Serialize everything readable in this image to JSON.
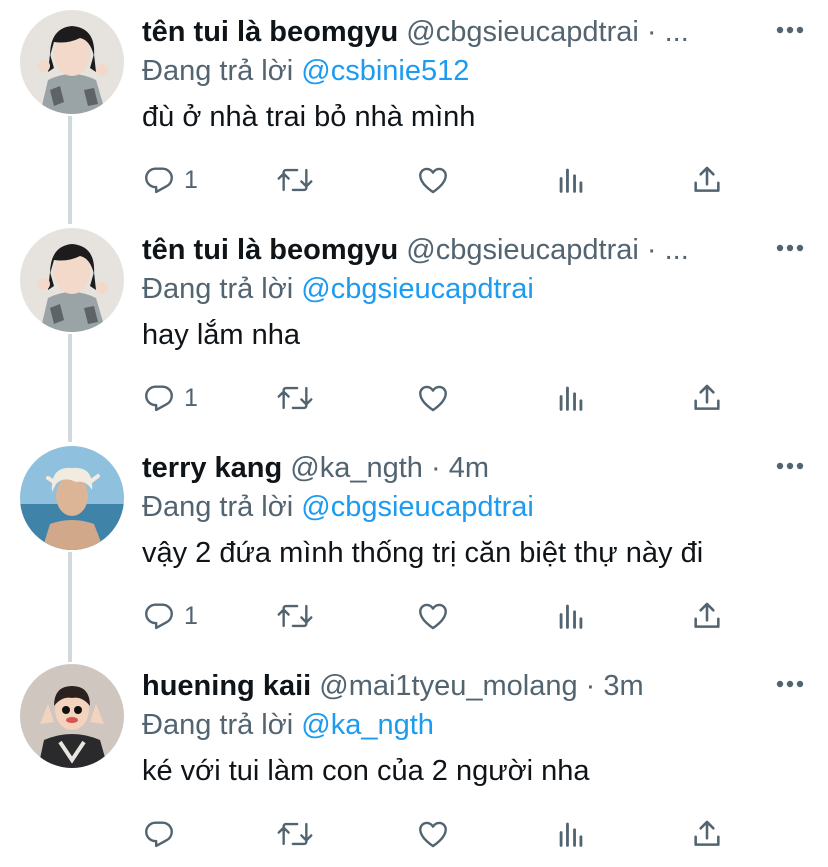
{
  "tweets": [
    {
      "display_name": "tên tui là beomgyu",
      "handle": "@cbgsieucapdtrai",
      "meta": "· ...",
      "replying_prefix": "Đang trả lời",
      "replying_to": "@csbinie512",
      "text": "đù ở nhà trai bỏ nhà mình",
      "reply_count": "1",
      "avatar_icon": "avatar-beomgyu"
    },
    {
      "display_name": "tên tui là beomgyu",
      "handle": "@cbgsieucapdtrai",
      "meta": "· ...",
      "replying_prefix": "Đang trả lời",
      "replying_to": "@cbgsieucapdtrai",
      "text": "hay lắm nha",
      "reply_count": "1",
      "avatar_icon": "avatar-beomgyu"
    },
    {
      "display_name": "terry kang",
      "handle": "@ka_ngth",
      "meta": "· 4m",
      "replying_prefix": "Đang trả lời",
      "replying_to": "@cbgsieucapdtrai",
      "text": "vậy 2 đứa mình thống trị căn biệt thự này đi",
      "reply_count": "1",
      "avatar_icon": "avatar-terry"
    },
    {
      "display_name": "huening kaii",
      "handle": "@mai1tyeu_molang",
      "meta": "· 3m",
      "replying_prefix": "Đang trả lời",
      "replying_to": "@ka_ngth",
      "text": "ké với tui làm con của 2 người nha",
      "reply_count": "",
      "avatar_icon": "avatar-huening"
    }
  ],
  "colors": {
    "text": "#0f1419",
    "secondary": "#536471",
    "link": "#1d9bf0",
    "thread_line": "#cfd9de"
  },
  "icons": [
    "reply-icon",
    "retweet-icon",
    "like-icon",
    "analytics-icon",
    "share-icon",
    "more-icon"
  ]
}
